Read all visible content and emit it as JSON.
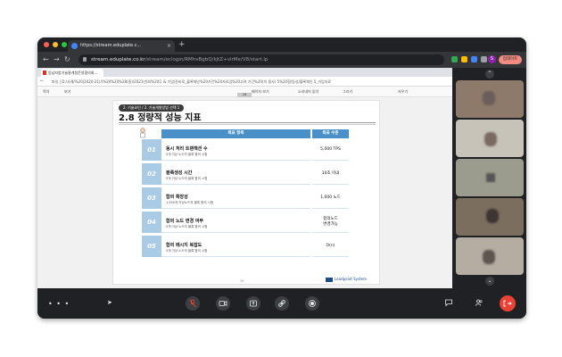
{
  "browser": {
    "tab_title": "https://stream.eduplate.c...",
    "url_host": "stream.eduplate.co.kr",
    "url_path": "/stream/eclogin/RMhvBgbQ/kjtZ+vlrMe/V8/start.lp",
    "update_label": "업데이트"
  },
  "pdf": {
    "tab_title": "동남지방기술통계청운영협의회...",
    "address": "파일  |  D:/사례/%20(2020-21)/(%20%20%28(중)/2021년/4/%20무 & 기업/준비로_블록체인%20기간%20자료검%20고려 기간%20(의 용사) 5%20협/동성/블록체인 5_키업자료",
    "toolbar": [
      "목차",
      "보기",
      "페이지 보기",
      "소리내어 읽기",
      "그리기",
      "지우기"
    ],
    "page_top": "28",
    "page_bottom": "36"
  },
  "slide": {
    "chapter": "2. 기술요인 / 2. 기술개발방법 선택 1",
    "title": "2.8 정량적 성능 지표",
    "col_goal": "목표 항목",
    "col_level": "목표 수준",
    "rows": [
      {
        "num": "01",
        "title": "동시 처리 트랜잭션 수",
        "sub": "5개 이상 노드의 블록 합의 시험",
        "value": "5,000 TPS"
      },
      {
        "num": "02",
        "title": "블록생성 시간",
        "sub": "5개 이상 노드의 블록 합의 시험",
        "value": "10초 이내"
      },
      {
        "num": "03",
        "title": "합의 확장성",
        "sub": "1,000개 가상노드의 블록 합의 시험",
        "value": "1,000 노드"
      },
      {
        "num": "04",
        "title": "합의 노드 변경 여부",
        "sub": "5개 이상 노드의 블록 합의 시험",
        "value": "합의노드\n변경가능"
      },
      {
        "num": "05",
        "title": "합의 메시지 복잡도",
        "sub": "5개 이상 노드의 블록 합의 시험",
        "value": "O(n)"
      }
    ],
    "logo_text": "Leadpoint System"
  },
  "controls": {
    "more": "• • •"
  }
}
